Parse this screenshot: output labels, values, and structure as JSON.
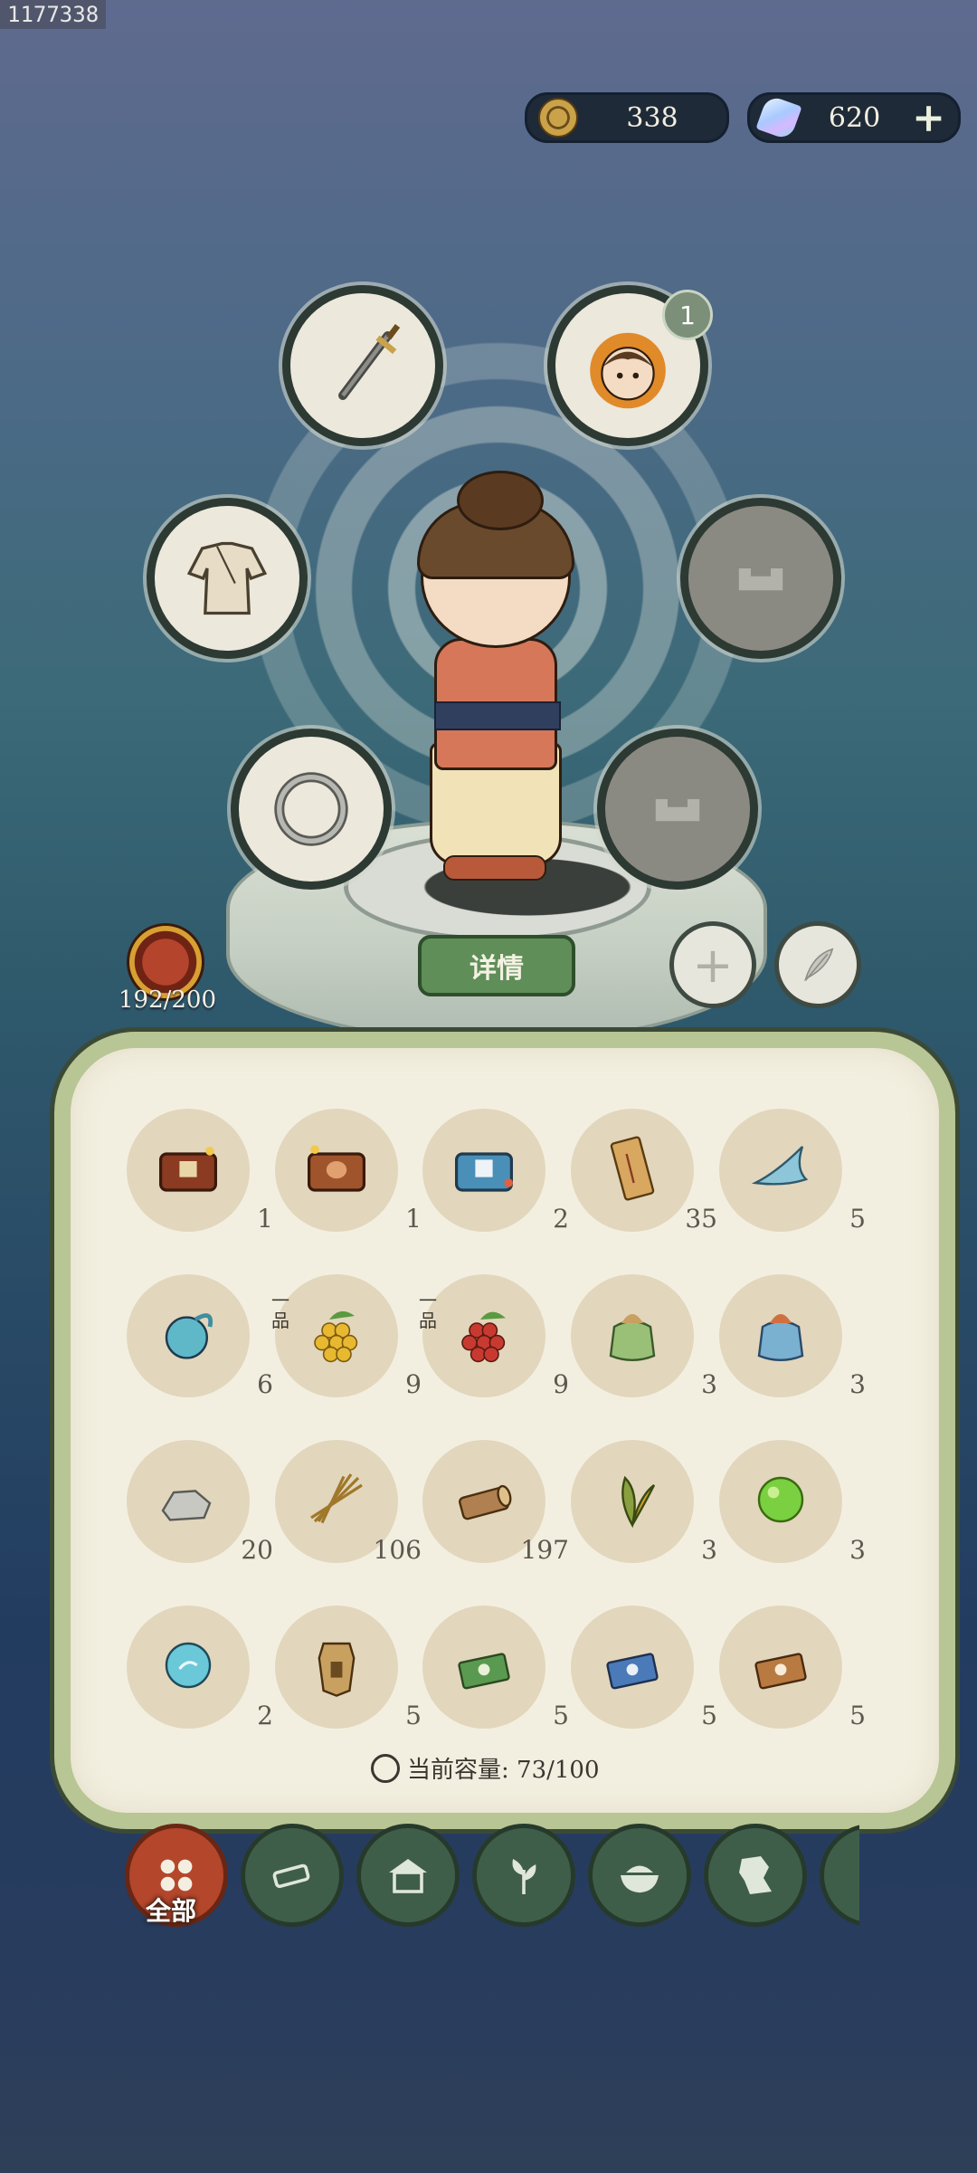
{
  "build_id": "1177338",
  "currency": {
    "coins": "338",
    "gems": "620",
    "add_label": "+"
  },
  "equipment": {
    "companion_badge": "1",
    "detail_label": "详情"
  },
  "energy": "192/200",
  "inventory": {
    "items": [
      {
        "icon": "treasure-chest-red",
        "count": "1"
      },
      {
        "icon": "treasure-chest-bag",
        "count": "1"
      },
      {
        "icon": "treasure-chest-blue",
        "count": "2"
      },
      {
        "icon": "scroll-paper",
        "count": "35"
      },
      {
        "icon": "flying-fish",
        "count": "5"
      },
      {
        "icon": "spirit-beetle",
        "count": "6"
      },
      {
        "icon": "golden-berries",
        "count": "9",
        "grade": "一品"
      },
      {
        "icon": "red-berries",
        "count": "9",
        "grade": "一品"
      },
      {
        "icon": "green-pouch",
        "count": "3"
      },
      {
        "icon": "blue-pouch",
        "count": "3"
      },
      {
        "icon": "stone",
        "count": "20"
      },
      {
        "icon": "hay-bundle",
        "count": "106"
      },
      {
        "icon": "wood-log",
        "count": "197"
      },
      {
        "icon": "herb-leaves",
        "count": "3"
      },
      {
        "icon": "green-orb",
        "count": "3"
      },
      {
        "icon": "blue-orb",
        "count": "2"
      },
      {
        "icon": "token-plaque",
        "count": "5"
      },
      {
        "icon": "green-book",
        "count": "5"
      },
      {
        "icon": "blue-book",
        "count": "5"
      },
      {
        "icon": "brown-book",
        "count": "5"
      }
    ],
    "capacity_label": "当前容量: 73/100"
  },
  "tabs": {
    "all_label": "全部",
    "icons": [
      "all-grid-icon",
      "wood-log-icon",
      "house-icon",
      "sprout-icon",
      "bowl-icon",
      "map-icon",
      "scroll-icon"
    ]
  },
  "colors": {
    "accent_green": "#5f8e58",
    "active_tab": "#b3462b",
    "panel_border": "#b8c594"
  }
}
